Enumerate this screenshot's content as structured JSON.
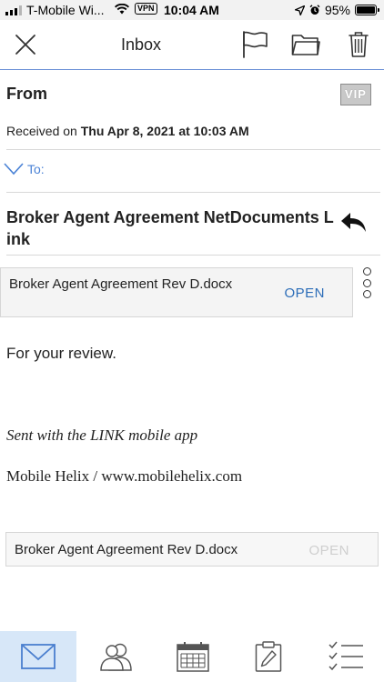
{
  "status_bar": {
    "carrier": "T-Mobile Wi...",
    "vpn": "VPN",
    "time": "10:04 AM",
    "battery": "95%"
  },
  "toolbar": {
    "title": "Inbox",
    "icons": [
      "close-icon",
      "flag-icon",
      "folder-icon",
      "trash-icon"
    ]
  },
  "message": {
    "from_label": "From",
    "vip_badge": "VIP",
    "received_prefix": "Received on",
    "received_date": "Thu Apr 8, 2021 at 10:03 AM",
    "to_label": "To:",
    "subject": "Broker Agent Agreement NetDocuments Link",
    "attachment": {
      "name": "Broker Agent Agreement Rev D.docx",
      "action": "OPEN"
    },
    "body": "For your review.",
    "signature_line1": "Sent with the LINK mobile app",
    "signature_line2": "Mobile Helix / www.mobilehelix.com",
    "inline_attachment": {
      "name": "Broker Agent Agreement Rev D.docx",
      "action": "OPEN"
    }
  },
  "tabbar": {
    "tabs": [
      "mail-tab",
      "contacts-tab",
      "calendar-tab",
      "tasks-tab",
      "checklist-tab"
    ],
    "active": "mail-tab"
  },
  "colors": {
    "accent": "#2c6db8",
    "link_blue": "#4a82d6",
    "active_tab_bg": "#d7e7f8",
    "toolbar_border": "#6a8fd6"
  }
}
